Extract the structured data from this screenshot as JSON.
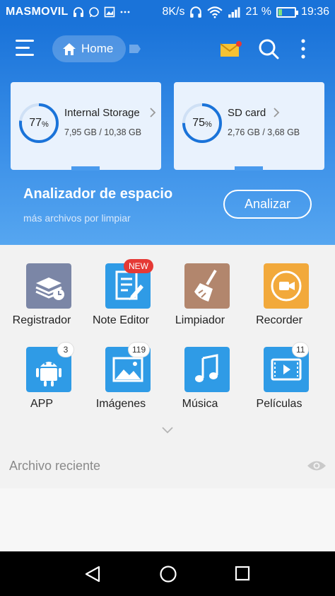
{
  "status_bar": {
    "carrier": "MASMOVIL",
    "speed": "8K/s",
    "battery_percent": "21 %",
    "battery_level": 0.21,
    "time": "19:36"
  },
  "topbar": {
    "home_label": "Home"
  },
  "storage": [
    {
      "name": "Internal Storage",
      "percent": "77",
      "percent_sign": "%",
      "used_fraction": 0.77,
      "sizes": "7,95 GB / 10,38 GB"
    },
    {
      "name": "SD card",
      "percent": "75",
      "percent_sign": "%",
      "used_fraction": 0.75,
      "sizes": "2,76 GB / 3,68 GB"
    }
  ],
  "analyzer": {
    "title": "Analizador de espacio",
    "subtitle": "más archivos por limpiar",
    "button": "Analizar"
  },
  "tools": [
    {
      "label": "Registrador",
      "icon": "register-icon"
    },
    {
      "label": "Note Editor",
      "icon": "note-editor-icon",
      "badge": "NEW"
    },
    {
      "label": "Limpiador",
      "icon": "broom-icon"
    },
    {
      "label": "Recorder",
      "icon": "recorder-icon"
    },
    {
      "label": "APP",
      "icon": "android-icon",
      "badge": "3"
    },
    {
      "label": "Imágenes",
      "icon": "image-icon",
      "badge": "119"
    },
    {
      "label": "Música",
      "icon": "music-icon"
    },
    {
      "label": "Películas",
      "icon": "video-icon",
      "badge": "11"
    }
  ],
  "recent": {
    "title": "Archivo reciente"
  },
  "colors": {
    "accent": "#1a73d9",
    "ring": "#1a73d9",
    "new_badge": "#e53935"
  }
}
